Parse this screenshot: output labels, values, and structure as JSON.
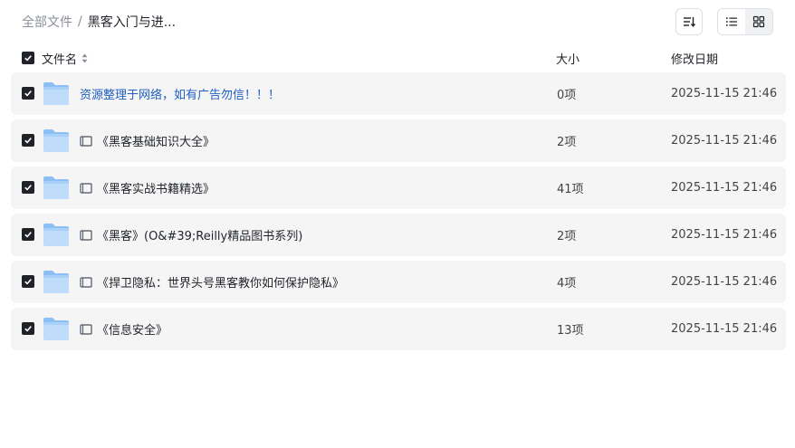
{
  "breadcrumb": {
    "root": "全部文件",
    "separator": "/",
    "current": "黑客入门与进..."
  },
  "header": {
    "name": "文件名",
    "size": "大小",
    "modified": "修改日期"
  },
  "files": [
    {
      "name": "资源整理于网络，如有广告勿信！！！",
      "size": "0项",
      "date": "2025-11-15 21:46",
      "has_book_icon": false,
      "is_link": true
    },
    {
      "name": "《黑客基础知识大全》",
      "size": "2项",
      "date": "2025-11-15 21:46",
      "has_book_icon": true,
      "is_link": false
    },
    {
      "name": "《黑客实战书籍精选》",
      "size": "41项",
      "date": "2025-11-15 21:46",
      "has_book_icon": true,
      "is_link": false
    },
    {
      "name": "《黑客》(O&#39;Reilly精品图书系列)",
      "size": "2项",
      "date": "2025-11-15 21:46",
      "has_book_icon": true,
      "is_link": false
    },
    {
      "name": "《捍卫隐私：世界头号黑客教你如何保护隐私》",
      "size": "4项",
      "date": "2025-11-15 21:46",
      "has_book_icon": true,
      "is_link": false
    },
    {
      "name": "《信息安全》",
      "size": "13项",
      "date": "2025-11-15 21:46",
      "has_book_icon": true,
      "is_link": false
    }
  ],
  "icons": {
    "sort": "sort-lines-icon",
    "list_view": "list-view-icon",
    "grid_view": "grid-view-icon",
    "folder": "folder-icon",
    "book": "book-icon",
    "check": "check-icon"
  },
  "colors": {
    "row_bg": "#f5f5f6",
    "checkbox": "#1f2328",
    "folder_light": "#bfdcfb",
    "folder_dark": "#8cc0f5",
    "link": "#1f5fbf"
  },
  "view_mode": "list"
}
